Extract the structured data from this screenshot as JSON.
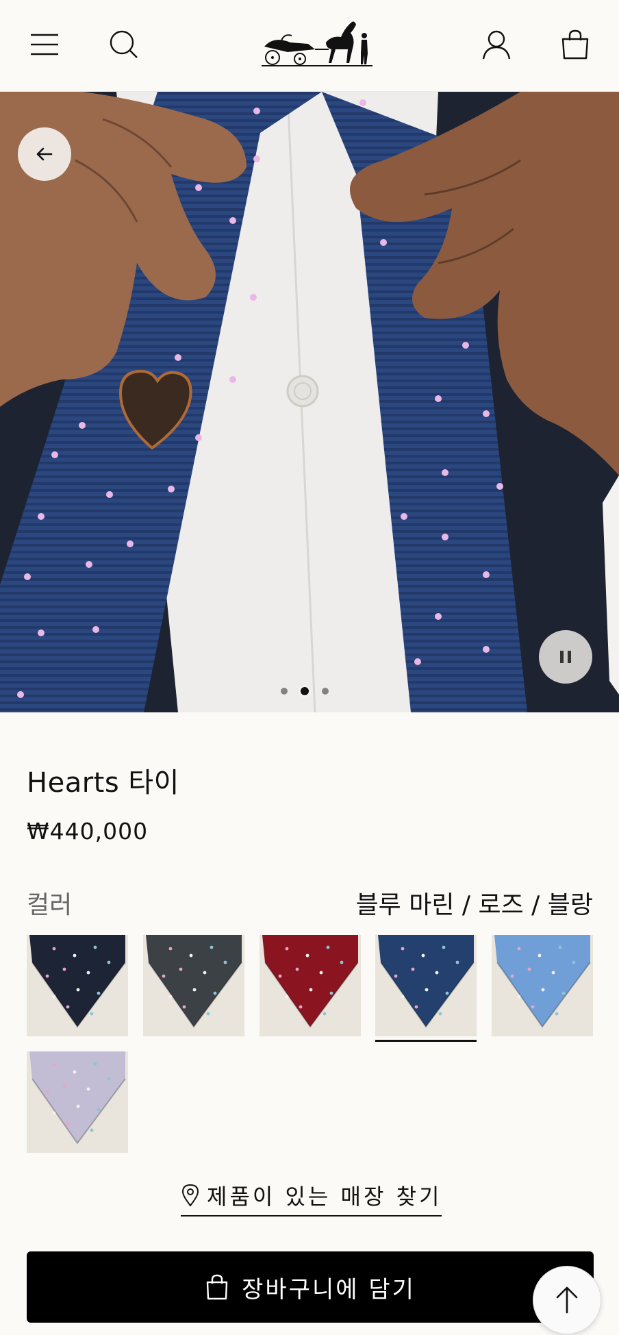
{
  "header": {
    "menu_icon": "hamburger-menu-icon",
    "search_icon": "search-icon",
    "logo_icon": "hermes-carriage-logo",
    "account_icon": "user-icon",
    "bag_icon": "shopping-bag-icon"
  },
  "hero": {
    "back_icon": "arrow-left-icon",
    "pause_icon": "pause-icon",
    "slides": 3,
    "active_slide": 2
  },
  "product": {
    "title": "Hearts 타이",
    "price": "₩440,000",
    "color_label": "컬러",
    "color_value": "블루 마린 / 로즈 / 블랑",
    "swatches": [
      {
        "color": "#1c2436"
      },
      {
        "color": "#3c4146"
      },
      {
        "color": "#8a1520"
      },
      {
        "color": "#23406e",
        "selected": true
      },
      {
        "color": "#6f9fd6"
      },
      {
        "color": "#c2bcd4"
      }
    ]
  },
  "actions": {
    "find_store": "제품이 있는 매장 찾기",
    "add_to_cart": "장바구니에 담기",
    "back_to_top_icon": "arrow-up-icon"
  },
  "colors": {
    "background": "#fcfaf6",
    "button": "#000000"
  }
}
